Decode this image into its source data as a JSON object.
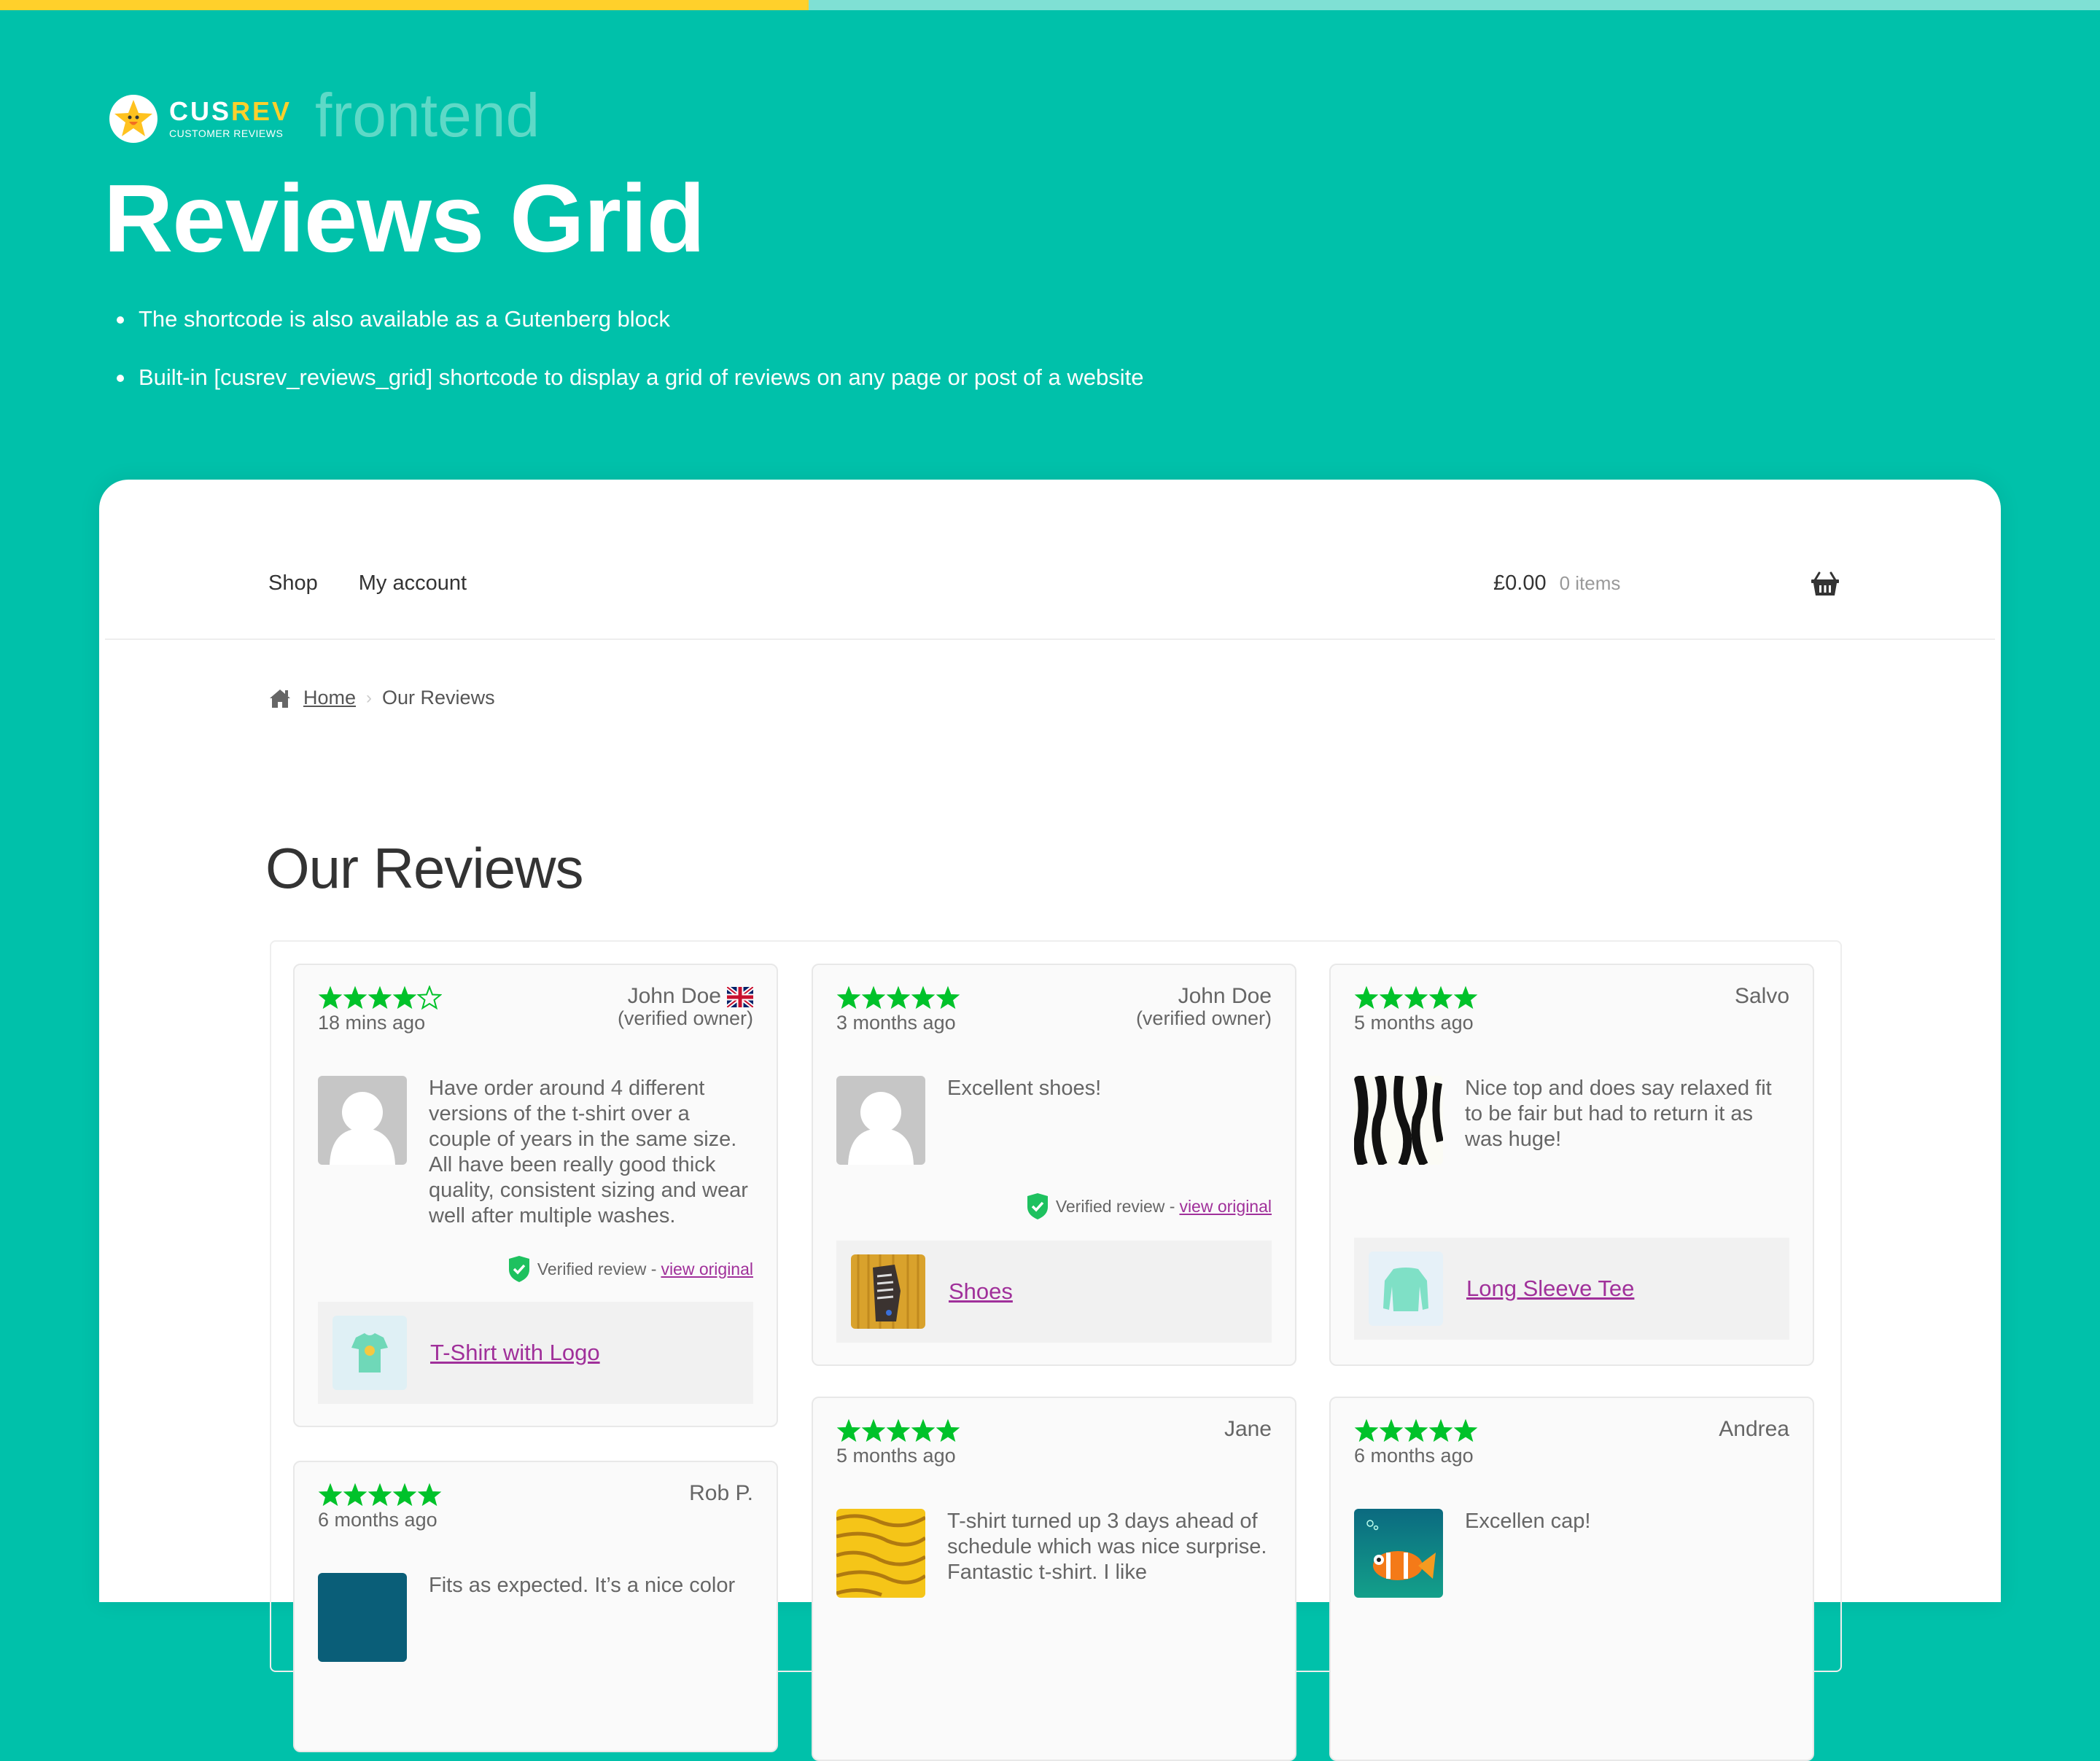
{
  "top_progress": {
    "fraction": 0.385,
    "fill_color": "#ffd02b",
    "track_color": "#7fe0d4"
  },
  "brand": {
    "word_part1": "CUS",
    "word_part2": "REV",
    "subtitle": "CUSTOMER REVIEWS",
    "tag": "frontend",
    "icon": "smiling-star-icon"
  },
  "hero": {
    "title": "Reviews Grid",
    "bullets": [
      "The shortcode is also available as a Gutenberg block",
      "Built-in [cusrev_reviews_grid] shortcode to display a grid of reviews on any page or post of a website"
    ]
  },
  "colors": {
    "background": "#00c1aa",
    "star": "#00c22a",
    "link": "#a0309a",
    "verified": "#1ec15f"
  },
  "site": {
    "nav": [
      "Shop",
      "My account"
    ],
    "cart_total": "£0.00",
    "cart_count": "0 items",
    "breadcrumb": {
      "home": "Home",
      "current": "Our Reviews"
    },
    "page_title": "Our Reviews"
  },
  "reviews": [
    {
      "rating": 4,
      "ago": "18 mins ago",
      "author": "John Doe",
      "owner_label": "(verified owner)",
      "flag": "uk-flag-icon",
      "text": "Have order around 4 different versions of the t-shirt over a couple of years in the same size. All have been really good thick quality, consistent sizing and wear well after multiple washes.",
      "avatar": "default-avatar",
      "verified_label": "Verified review -",
      "verified_link": "view original",
      "product": "T-Shirt with Logo"
    },
    {
      "rating": 5,
      "ago": "3 months ago",
      "author": "John Doe",
      "owner_label": "(verified owner)",
      "text": "Excellent shoes!",
      "avatar": "default-avatar",
      "verified_label": "Verified review -",
      "verified_link": "view original",
      "product": "Shoes"
    },
    {
      "rating": 5,
      "ago": "5 months ago",
      "author": "Salvo",
      "text": "Nice top and does say relaxed fit to be fair but had to return it as was huge!",
      "avatar": "zebra-pattern",
      "product": "Long Sleeve Tee"
    },
    {
      "rating": 5,
      "ago": "6 months ago",
      "author": "Rob P.",
      "text": "Fits as expected. It’s a nice color",
      "avatar": "teal-image"
    },
    {
      "rating": 5,
      "ago": "5 months ago",
      "author": "Jane",
      "text": "T-shirt turned up 3 days ahead of schedule which was nice surprise. Fantastic t-shirt. I like",
      "avatar": "tiger-pattern"
    },
    {
      "rating": 5,
      "ago": "6 months ago",
      "author": "Andrea",
      "text": "Excellen cap!",
      "avatar": "clownfish-image"
    }
  ]
}
